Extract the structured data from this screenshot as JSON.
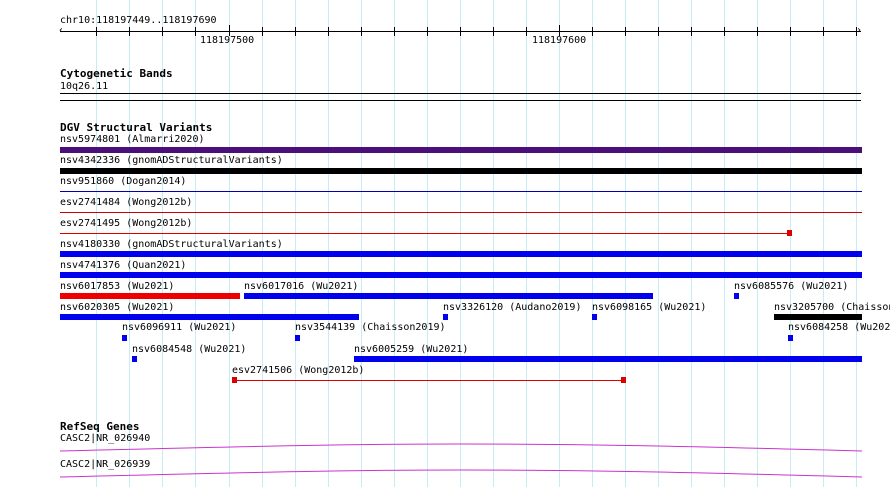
{
  "ruler": {
    "locus": "chr10:118197449..118197690",
    "tick_labels": [
      "118197500",
      "118197600"
    ]
  },
  "cytoband": {
    "heading": "Cytogenetic Bands",
    "band": "10q26.11"
  },
  "dgv": {
    "heading": "DGV Structural Variants",
    "features": [
      {
        "label": "nsv5974801 (Almarri2020)",
        "color": "#4b0f7a",
        "style": "thick"
      },
      {
        "label": "nsv4342336 (gnomADStructuralVariants)",
        "color": "#000000",
        "style": "thick"
      },
      {
        "label": "nsv951860 (Dogan2014)",
        "color": "#0000b0",
        "style": "line"
      },
      {
        "label": "esv2741484 (Wong2012b)",
        "color": "#cc0000",
        "style": "line"
      },
      {
        "label": "esv2741495 (Wong2012b)",
        "color": "#dd0000",
        "style": "line-end"
      },
      {
        "label": "nsv4180330 (gnomADStructuralVariants)",
        "color": "#0000ee",
        "style": "thick"
      },
      {
        "label": "nsv4741376 (Quan2021)",
        "color": "#0000ee",
        "style": "thick"
      },
      {
        "label": "nsv6017853 (Wu2021)",
        "color": "#ee0000",
        "style": "thick"
      },
      {
        "label": "nsv6017016 (Wu2021)",
        "color": "#0000ee",
        "style": "thick"
      },
      {
        "label": "nsv6085576 (Wu2021)",
        "color": "#0000ee",
        "style": "dot"
      },
      {
        "label": "nsv6020305 (Wu2021)",
        "color": "#0000ee",
        "style": "thick"
      },
      {
        "label": "nsv3326120 (Audano2019)",
        "color": "#0000ee",
        "style": "dot"
      },
      {
        "label": "nsv6098165 (Wu2021)",
        "color": "#0000ee",
        "style": "dot"
      },
      {
        "label": "nsv3205700 (Chaisson",
        "color": "#000000",
        "style": "thick"
      },
      {
        "label": "nsv6096911 (Wu2021)",
        "color": "#0000ee",
        "style": "dot"
      },
      {
        "label": "nsv3544139 (Chaisson2019)",
        "color": "#0000ee",
        "style": "dot"
      },
      {
        "label": "nsv6084258 (Wu202",
        "color": "#0000ee",
        "style": "dot"
      },
      {
        "label": "nsv6084548 (Wu2021)",
        "color": "#0000ee",
        "style": "dot"
      },
      {
        "label": "nsv6005259 (Wu2021)",
        "color": "#0000ee",
        "style": "thick"
      },
      {
        "label": "esv2741506 (Wong2012b)",
        "color": "#dd0000",
        "style": "line-both"
      }
    ]
  },
  "refseq": {
    "heading": "RefSeq Genes",
    "genes": [
      {
        "label": "CASC2|NR_026940",
        "color": "#cc33cc"
      },
      {
        "label": "CASC2|NR_026939",
        "color": "#cc33cc"
      }
    ]
  }
}
